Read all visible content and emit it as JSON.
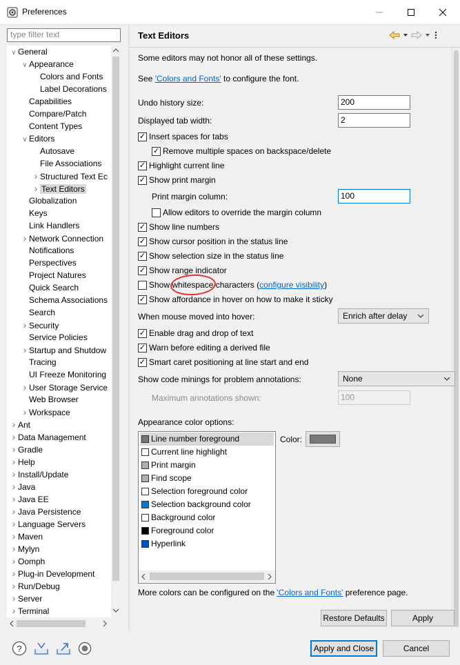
{
  "window": {
    "title": "Preferences"
  },
  "filter": {
    "placeholder": "type filter text"
  },
  "tree": [
    {
      "label": "General",
      "indent": 0,
      "arrow": "down"
    },
    {
      "label": "Appearance",
      "indent": 1,
      "arrow": "down"
    },
    {
      "label": "Colors and Fonts",
      "indent": 2,
      "arrow": ""
    },
    {
      "label": "Label Decorations",
      "indent": 2,
      "arrow": ""
    },
    {
      "label": "Capabilities",
      "indent": 1,
      "arrow": ""
    },
    {
      "label": "Compare/Patch",
      "indent": 1,
      "arrow": ""
    },
    {
      "label": "Content Types",
      "indent": 1,
      "arrow": ""
    },
    {
      "label": "Editors",
      "indent": 1,
      "arrow": "down"
    },
    {
      "label": "Autosave",
      "indent": 2,
      "arrow": ""
    },
    {
      "label": "File Associations",
      "indent": 2,
      "arrow": ""
    },
    {
      "label": "Structured Text Ec",
      "indent": 2,
      "arrow": "right"
    },
    {
      "label": "Text Editors",
      "indent": 2,
      "arrow": "right",
      "selected": true
    },
    {
      "label": "Globalization",
      "indent": 1,
      "arrow": ""
    },
    {
      "label": "Keys",
      "indent": 1,
      "arrow": ""
    },
    {
      "label": "Link Handlers",
      "indent": 1,
      "arrow": ""
    },
    {
      "label": "Network Connection",
      "indent": 1,
      "arrow": "right"
    },
    {
      "label": "Notifications",
      "indent": 1,
      "arrow": ""
    },
    {
      "label": "Perspectives",
      "indent": 1,
      "arrow": ""
    },
    {
      "label": "Project Natures",
      "indent": 1,
      "arrow": ""
    },
    {
      "label": "Quick Search",
      "indent": 1,
      "arrow": ""
    },
    {
      "label": "Schema Associations",
      "indent": 1,
      "arrow": ""
    },
    {
      "label": "Search",
      "indent": 1,
      "arrow": ""
    },
    {
      "label": "Security",
      "indent": 1,
      "arrow": "right"
    },
    {
      "label": "Service Policies",
      "indent": 1,
      "arrow": ""
    },
    {
      "label": "Startup and Shutdow",
      "indent": 1,
      "arrow": "right"
    },
    {
      "label": "Tracing",
      "indent": 1,
      "arrow": ""
    },
    {
      "label": "UI Freeze Monitoring",
      "indent": 1,
      "arrow": ""
    },
    {
      "label": "User Storage Service",
      "indent": 1,
      "arrow": "right"
    },
    {
      "label": "Web Browser",
      "indent": 1,
      "arrow": ""
    },
    {
      "label": "Workspace",
      "indent": 1,
      "arrow": "right"
    },
    {
      "label": "Ant",
      "indent": 0,
      "arrow": "right"
    },
    {
      "label": "Data Management",
      "indent": 0,
      "arrow": "right"
    },
    {
      "label": "Gradle",
      "indent": 0,
      "arrow": "right"
    },
    {
      "label": "Help",
      "indent": 0,
      "arrow": "right"
    },
    {
      "label": "Install/Update",
      "indent": 0,
      "arrow": "right"
    },
    {
      "label": "Java",
      "indent": 0,
      "arrow": "right"
    },
    {
      "label": "Java EE",
      "indent": 0,
      "arrow": "right"
    },
    {
      "label": "Java Persistence",
      "indent": 0,
      "arrow": "right"
    },
    {
      "label": "Language Servers",
      "indent": 0,
      "arrow": "right"
    },
    {
      "label": "Maven",
      "indent": 0,
      "arrow": "right"
    },
    {
      "label": "Mylyn",
      "indent": 0,
      "arrow": "right"
    },
    {
      "label": "Oomph",
      "indent": 0,
      "arrow": "right"
    },
    {
      "label": "Plug-in Development",
      "indent": 0,
      "arrow": "right"
    },
    {
      "label": "Run/Debug",
      "indent": 0,
      "arrow": "right"
    },
    {
      "label": "Server",
      "indent": 0,
      "arrow": "right"
    },
    {
      "label": "Terminal",
      "indent": 0,
      "arrow": "right"
    }
  ],
  "page": {
    "title": "Text Editors",
    "note": "Some editors may not honor all of these settings.",
    "see_prefix": "See ",
    "colors_fonts_link": "'Colors and Fonts'",
    "see_suffix": " to configure the font.",
    "undo_label": "Undo history size:",
    "undo_value": "200",
    "tab_width_label": "Displayed tab width:",
    "tab_width_value": "2",
    "insert_spaces": {
      "label": "Insert spaces for tabs",
      "checked": true
    },
    "remove_spaces": {
      "label": "Remove multiple spaces on backspace/delete",
      "checked": true
    },
    "highlight_line": {
      "label": "Highlight current line",
      "checked": true
    },
    "print_margin": {
      "label": "Show print margin",
      "checked": true
    },
    "margin_column_label": "Print margin column:",
    "margin_column_value": "100",
    "allow_override": {
      "label": "Allow editors to override the margin column",
      "checked": false
    },
    "line_numbers": {
      "label": "Show line numbers",
      "checked": true
    },
    "cursor_pos": {
      "label": "Show cursor position in the status line",
      "checked": true
    },
    "selection_size": {
      "label": "Show selection size in the status line",
      "checked": true
    },
    "range_indicator": {
      "label": "Show range indicator",
      "checked": true
    },
    "whitespace_prefix": "Show ",
    "whitespace_word": "whitespace",
    "whitespace_suffix": " characters (",
    "configure_visibility": "configure visibility",
    "whitespace_close": ")",
    "whitespace_checked": false,
    "affordance": {
      "label": "Show affordance in hover on how to make it sticky",
      "checked": true
    },
    "hover_label": "When mouse moved into hover:",
    "hover_value": "Enrich after delay",
    "drag_drop": {
      "label": "Enable drag and drop of text",
      "checked": true
    },
    "warn_derived": {
      "label": "Warn before editing a derived file",
      "checked": true
    },
    "smart_caret": {
      "label": "Smart caret positioning at line start and end",
      "checked": true
    },
    "minings_label": "Show code minings for problem annotations:",
    "minings_value": "None",
    "max_annotations_label": "Maximum annotations shown:",
    "max_annotations_value": "100",
    "appearance_label": "Appearance color options:",
    "color_label": "Color:",
    "color_options": [
      {
        "label": "Line number foreground",
        "color": "#787878",
        "selected": true
      },
      {
        "label": "Current line highlight",
        "color": "#ffffff"
      },
      {
        "label": "Print margin",
        "color": "#b0b0b0"
      },
      {
        "label": "Find scope",
        "color": "#b0b0b0"
      },
      {
        "label": "Selection foreground color",
        "color": "#ffffff"
      },
      {
        "label": "Selection background color",
        "color": "#0078d7"
      },
      {
        "label": "Background color",
        "color": "#ffffff"
      },
      {
        "label": "Foreground color",
        "color": "#000000"
      },
      {
        "label": "Hyperlink",
        "color": "#0050c8"
      }
    ],
    "current_color": "#787878",
    "more_colors_prefix": "More colors can be configured on the ",
    "more_colors_link": "'Colors and Fonts'",
    "more_colors_suffix": " preference page.",
    "restore_defaults": "Restore Defaults",
    "apply": "Apply"
  },
  "footer": {
    "apply_close": "Apply and Close",
    "cancel": "Cancel"
  },
  "colors": {
    "link": "#0066cc",
    "accent": "#0078d7",
    "annotation": "#e03131"
  }
}
